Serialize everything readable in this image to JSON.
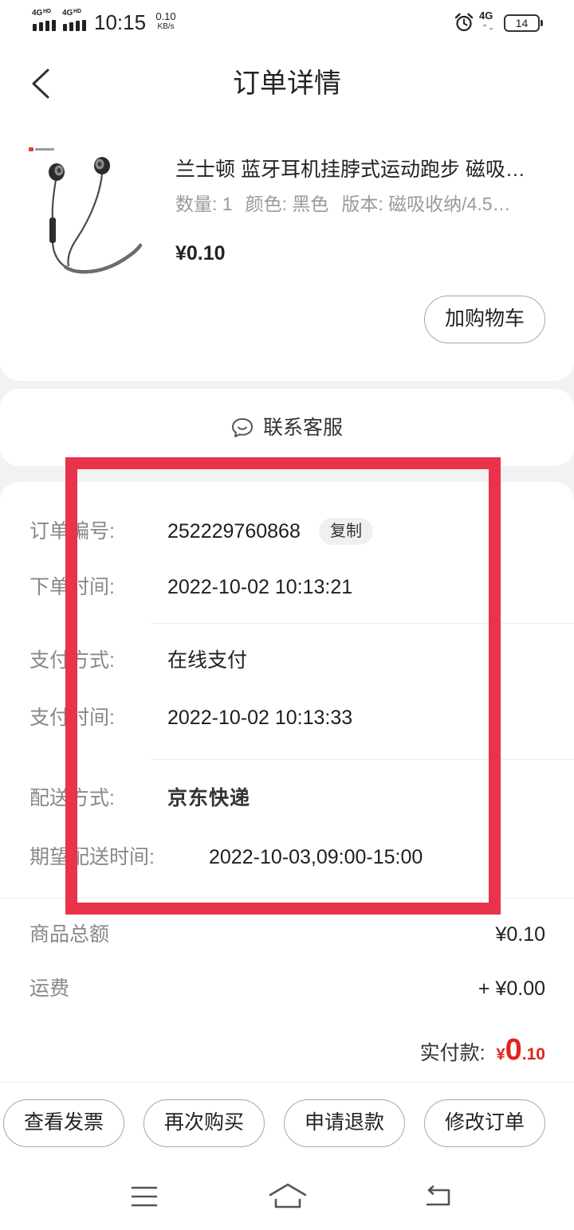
{
  "theme": {
    "accent_red": "#e2231a",
    "highlight_box": "#e8334a",
    "page_background": "#f2f2f2"
  },
  "status_bar": {
    "sim1_type": "4G",
    "sim1_hd": "HD",
    "sim2_type": "4G",
    "sim2_hd": "HD",
    "time": "10:15",
    "net_speed": "0.10",
    "net_speed_unit": "KB/s",
    "network": "4G",
    "battery": "14",
    "icons": [
      "signal-bars-icon",
      "alarm-clock-icon",
      "battery-icon"
    ]
  },
  "header": {
    "title": "订单详情",
    "back_icon": "chevron-left-icon"
  },
  "product": {
    "image": "earphones-icon",
    "title": "兰士顿 蓝牙耳机挂脖式运动跑步 磁吸…",
    "specs": {
      "quantity": "数量: 1",
      "color": "颜色: 黑色",
      "version": "版本: 磁吸收纳/4.5…"
    },
    "price": "¥0.10",
    "add_to_cart_label": "加购物车"
  },
  "customer_service": {
    "icon": "chat-bubble-icon",
    "label": "联系客服"
  },
  "order_info": {
    "order_number": {
      "label": "订单编号:",
      "value": "252229760868",
      "copy_label": "复制"
    },
    "order_time": {
      "label": "下单时间:",
      "value": "2022-10-02 10:13:21"
    },
    "payment_method": {
      "label": "支付方式:",
      "value": "在线支付"
    },
    "payment_time": {
      "label": "支付时间:",
      "value": "2022-10-02 10:13:33"
    },
    "delivery_method": {
      "label": "配送方式:",
      "value": "京东快递"
    },
    "expected_delivery": {
      "label": "期望配送时间:",
      "value": "2022-10-03,09:00-15:00"
    }
  },
  "totals": {
    "goods_total": {
      "label": "商品总额",
      "value": "¥0.10"
    },
    "shipping": {
      "label": "运费",
      "value": "+ ¥0.00"
    },
    "paid": {
      "label": "实付款:",
      "currency": "¥",
      "integer": "0",
      "decimal": ".10"
    }
  },
  "bottom_actions": [
    {
      "label": "查看发票"
    },
    {
      "label": "再次购买"
    },
    {
      "label": "申请退款"
    },
    {
      "label": "修改订单"
    }
  ],
  "nav_bar": {
    "icons": [
      "menu-icon",
      "home-icon",
      "back-icon"
    ]
  }
}
